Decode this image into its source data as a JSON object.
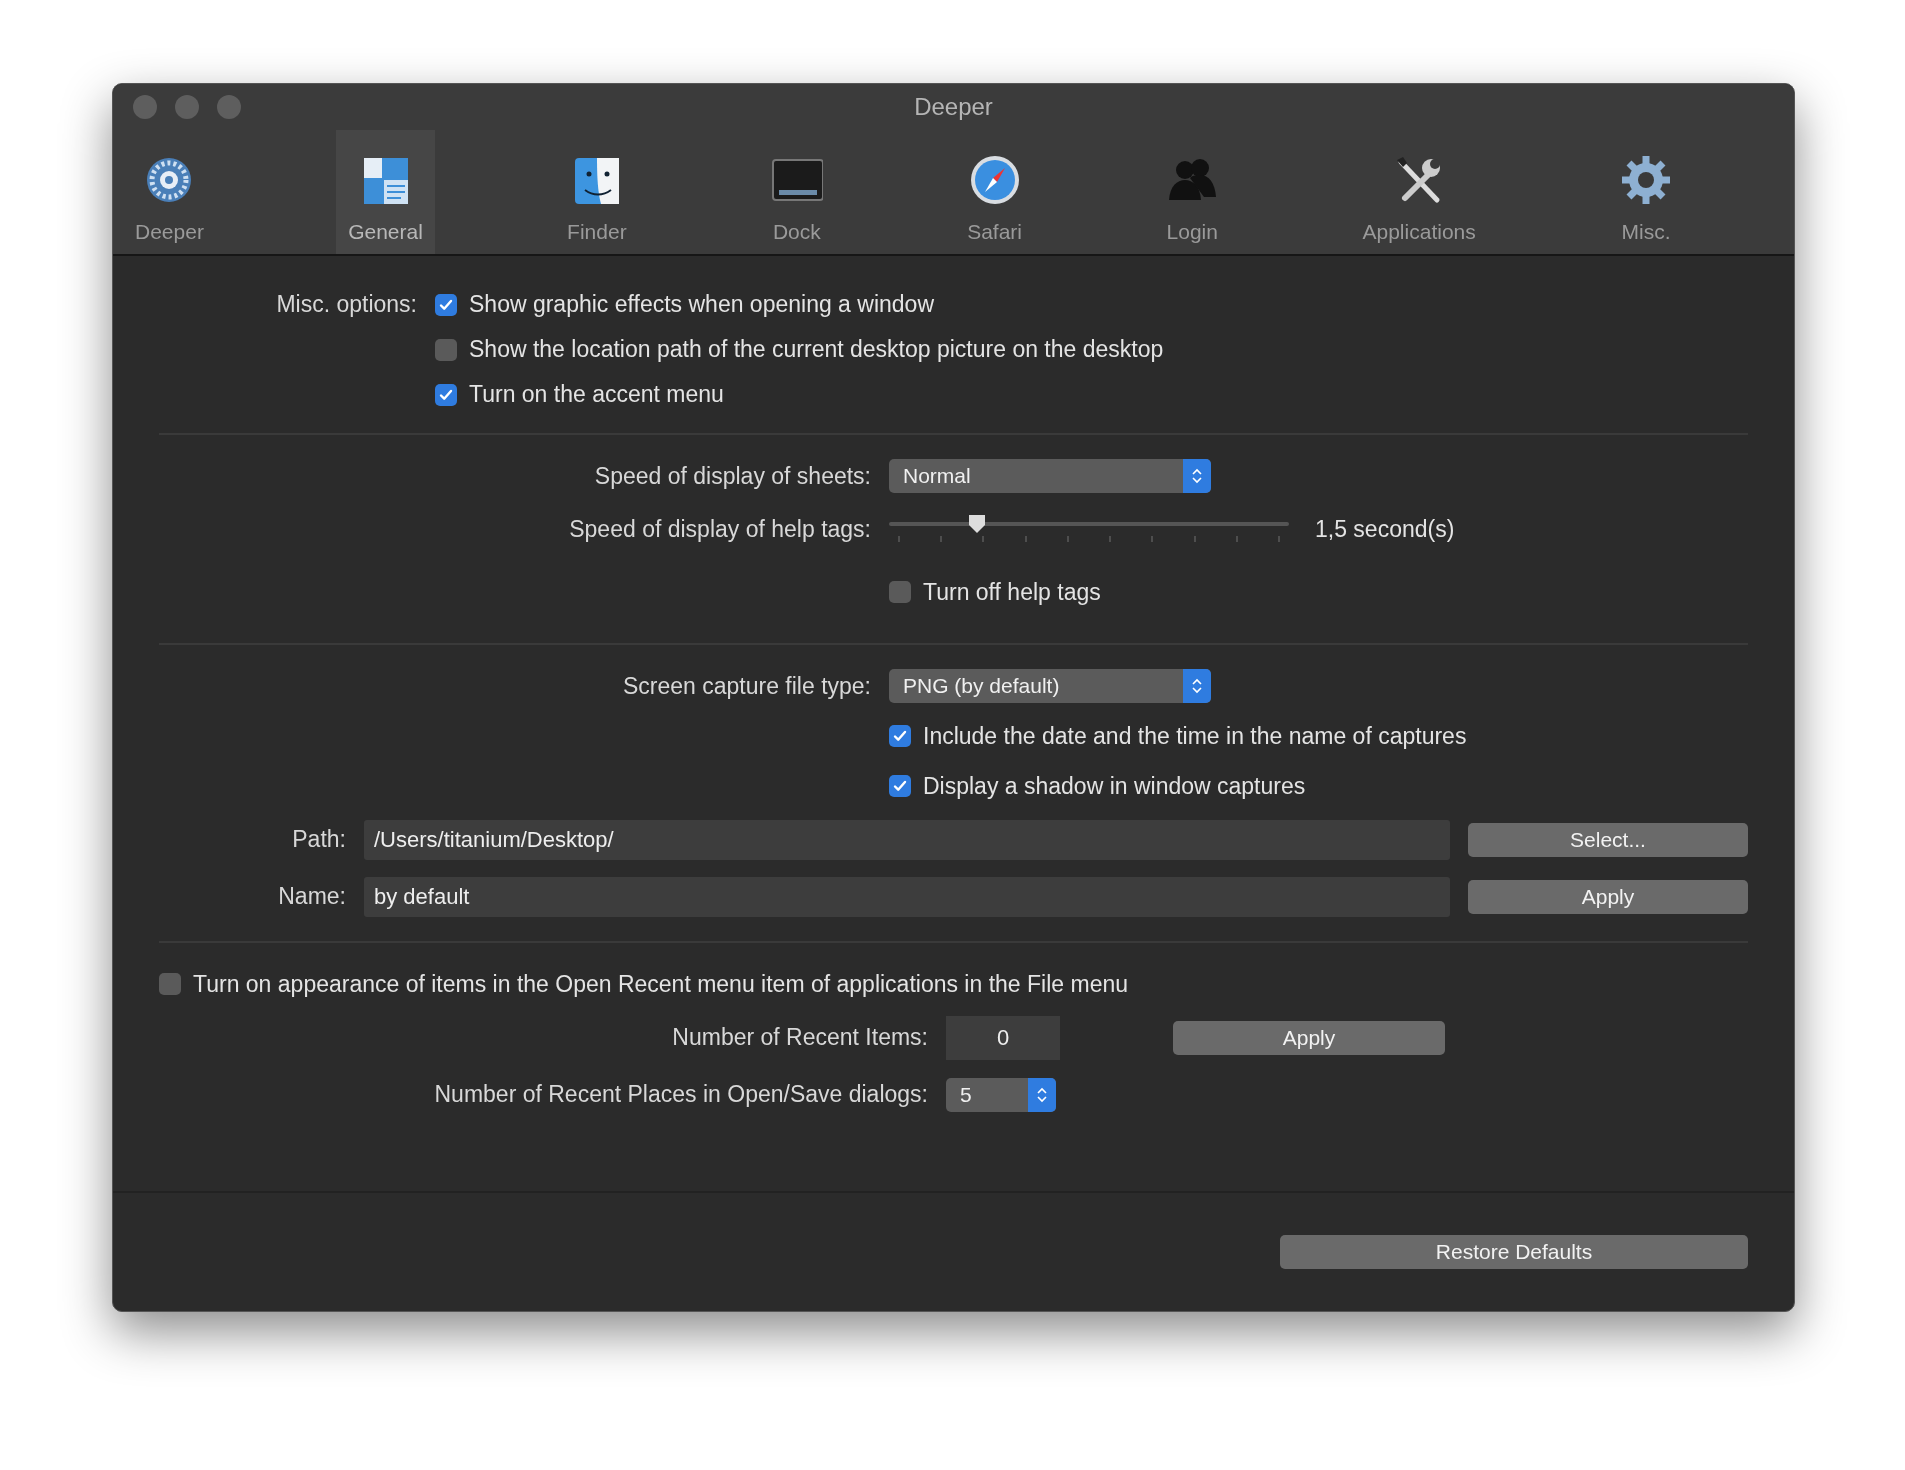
{
  "window": {
    "title": "Deeper"
  },
  "toolbar": [
    {
      "label": "Deeper",
      "selected": false
    },
    {
      "label": "General",
      "selected": true
    },
    {
      "label": "Finder",
      "selected": false
    },
    {
      "label": "Dock",
      "selected": false
    },
    {
      "label": "Safari",
      "selected": false
    },
    {
      "label": "Login",
      "selected": false
    },
    {
      "label": "Applications",
      "selected": false
    },
    {
      "label": "Misc.",
      "selected": false
    }
  ],
  "misc_options": {
    "label": "Misc. options:",
    "options": [
      {
        "label": "Show graphic effects when opening a window",
        "checked": true
      },
      {
        "label": "Show the location path of the current desktop picture on the desktop",
        "checked": false
      },
      {
        "label": "Turn on the accent menu",
        "checked": true
      }
    ]
  },
  "sheets_speed": {
    "label": "Speed of display of sheets:",
    "value": "Normal"
  },
  "help_tags_speed": {
    "label": "Speed of display of help tags:",
    "level": 0.22,
    "reading": "1,5 second(s)"
  },
  "turn_off_help_tags": {
    "label": "Turn off help tags",
    "checked": false
  },
  "capture_type": {
    "label": "Screen capture file type:",
    "value": "PNG (by default)"
  },
  "capture_options": [
    {
      "label": "Include the date and the time in the name of captures",
      "checked": true
    },
    {
      "label": "Display a shadow in window captures",
      "checked": true
    }
  ],
  "path": {
    "label": "Path:",
    "value": "/Users/titanium/Desktop/",
    "button": "Select..."
  },
  "name": {
    "label": "Name:",
    "value": "by default",
    "button": "Apply"
  },
  "open_recent": {
    "label": "Turn on appearance of items in the Open Recent menu item of applications in the File menu",
    "checked": false
  },
  "recent_items": {
    "label": "Number of Recent Items:",
    "value": "0",
    "button": "Apply"
  },
  "recent_places": {
    "label": "Number of Recent Places in Open/Save dialogs:",
    "value": "5"
  },
  "restore_button": "Restore Defaults"
}
